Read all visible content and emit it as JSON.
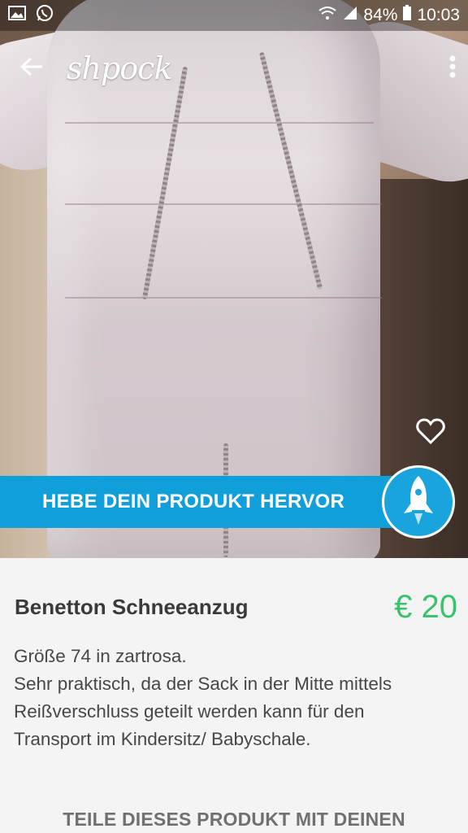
{
  "status_bar": {
    "battery": "84%",
    "time": "10:03",
    "icons": [
      "gallery-icon",
      "whatsapp-icon",
      "wifi-icon",
      "signal-icon",
      "battery-icon"
    ]
  },
  "app_bar": {
    "logo": "shpock",
    "back_icon": "arrow-back-icon",
    "menu_icon": "more-vert-icon"
  },
  "promo": {
    "label": "HEBE DEIN PRODUKT HERVOR",
    "icon": "rocket-icon",
    "color": "#109fd9"
  },
  "favorite_icon": "heart-outline-icon",
  "product": {
    "title": "Benetton Schneeanzug",
    "price": "€ 20",
    "price_color": "#39c36d",
    "description_lines": [
      "Größe 74 in zartrosa.",
      "Sehr praktisch, da der Sack in der Mitte mittels",
      "Reißverschluss geteilt werden kann für den",
      "Transport im Kindersitz/ Babyschale."
    ]
  },
  "share_heading": "TEILE DIESES PRODUKT MIT DEINEN"
}
